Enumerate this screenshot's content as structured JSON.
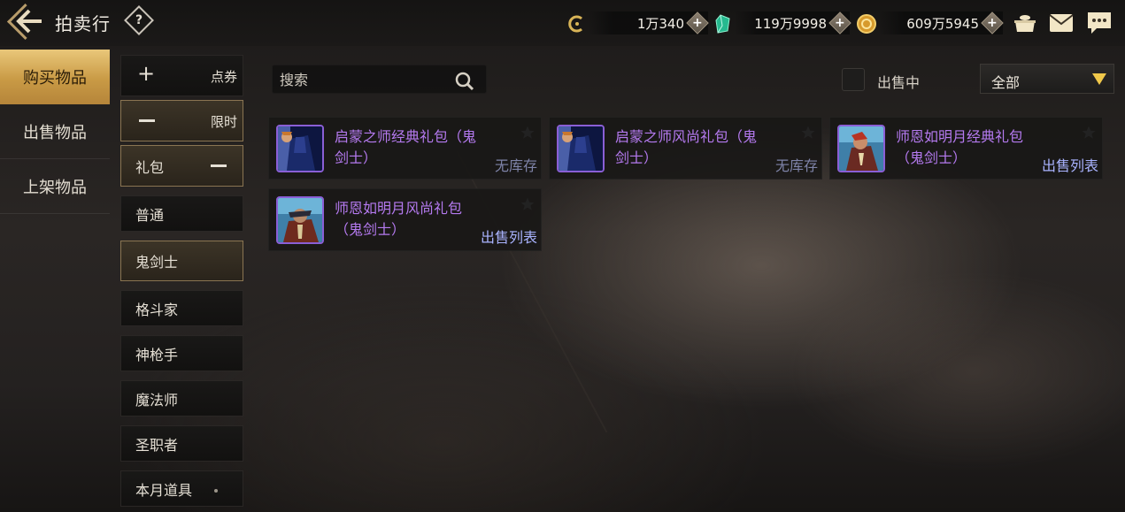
{
  "header": {
    "title": "拍卖行",
    "currencies": [
      {
        "icon": "c-coin-icon",
        "amount": "1万340"
      },
      {
        "icon": "green-crystal-icon",
        "amount": "119万9998"
      },
      {
        "icon": "gold-coin-icon",
        "amount": "609万5945"
      }
    ]
  },
  "left_nav": {
    "items": [
      {
        "label": "购买物品",
        "active": true
      },
      {
        "label": "出售物品",
        "active": false
      },
      {
        "label": "上架物品",
        "active": false
      }
    ]
  },
  "categories": {
    "coupon": {
      "label": "点券"
    },
    "limited": {
      "label": "限时"
    },
    "package": {
      "label": "礼包"
    },
    "subs": [
      "普通",
      "鬼剑士",
      "格斗家",
      "神枪手",
      "魔法师",
      "圣职者",
      "本月道具"
    ]
  },
  "search": {
    "placeholder": "搜索"
  },
  "filter": {
    "on_sale_label": "出售中",
    "dropdown_value": "全部"
  },
  "items": [
    {
      "name": "启蒙之师经典礼包（鬼剑士）",
      "status": "无库存"
    },
    {
      "name": "启蒙之师风尚礼包（鬼剑士）",
      "status": "无库存"
    },
    {
      "name": "师恩如明月经典礼包（鬼剑士）",
      "status": "出售列表"
    },
    {
      "name": "师恩如明月风尚礼包（鬼剑士）",
      "status": "出售列表"
    }
  ],
  "colors": {
    "accent_gold": "#c99a45",
    "item_purple": "#b57af0",
    "list_blue": "#a9b3ff",
    "no_stock": "#7e83a8"
  }
}
